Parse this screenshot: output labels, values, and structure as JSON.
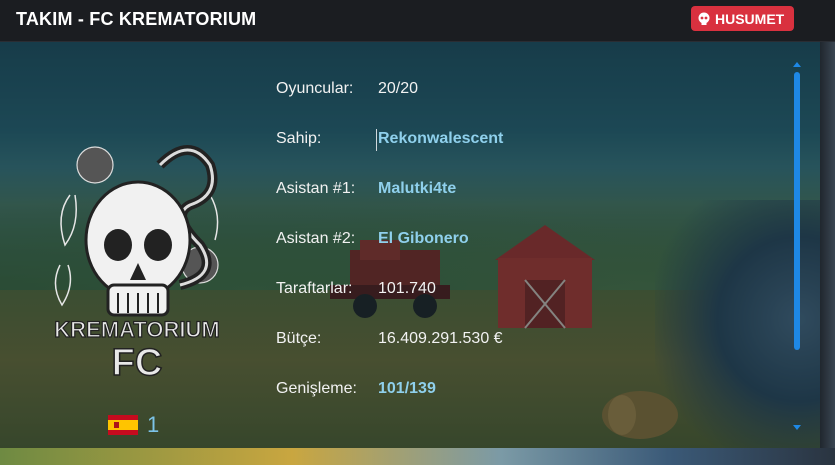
{
  "header": {
    "title": "TAKIM - FC KREMATORIUM",
    "badge_label": "HUSUMET",
    "badge_color": "#d9313f",
    "badge_icon": "skull-icon"
  },
  "logo": {
    "text_line1": "KREMATORIUM",
    "text_line2": "FC"
  },
  "country": {
    "flag": "spain-flag",
    "number": "1"
  },
  "info": {
    "rows": [
      {
        "label": "Oyuncular:",
        "value": "20/20"
      },
      {
        "label": "Sahip:",
        "value": "Rekonwalescent"
      },
      {
        "label": "Asistan #1:",
        "value": "Malutki4te"
      },
      {
        "label": "Asistan #2:",
        "value": "El Gibonero"
      },
      {
        "label": "Taraftarlar:",
        "value": "101.740"
      },
      {
        "label": "Bütçe:",
        "value": "16.409.291.530 €"
      },
      {
        "label": "Genişleme:",
        "value": "101/139"
      }
    ]
  },
  "colors": {
    "accent": "#1e88e5",
    "link": "#8fd0ec"
  }
}
